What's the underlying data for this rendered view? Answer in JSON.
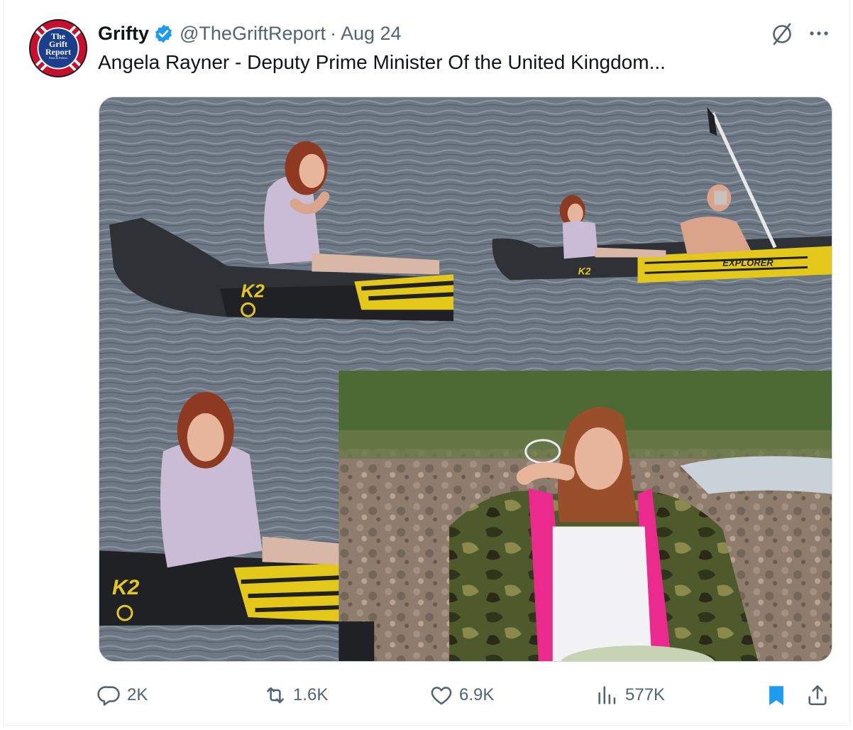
{
  "author": {
    "name": "Grifty",
    "handle": "@TheGriftReport",
    "separator": "·",
    "date": "Aug 24",
    "avatar_lines": [
      "The",
      "Grift",
      "Report"
    ],
    "avatar_subtext": "News & Politics"
  },
  "tweet": {
    "text": "Angela Rayner - Deputy Prime Minister Of the United Kingdom..."
  },
  "media": {
    "kayak_labels": [
      "K2",
      "K2",
      "K2",
      "EXPLORER"
    ]
  },
  "actions": {
    "replies": "2K",
    "reposts": "1.6K",
    "likes": "6.9K",
    "views": "577K"
  },
  "icons": {
    "verified": "verified-badge-icon",
    "grok": "grok-icon",
    "more": "more-icon",
    "reply": "reply-icon",
    "repost": "repost-icon",
    "like": "heart-icon",
    "views": "views-icon",
    "bookmark": "bookmark-icon",
    "share": "share-icon"
  },
  "colors": {
    "verified": "#1d9bf0",
    "bookmark": "#1d9bf0",
    "secondary_text": "#536471",
    "kayak_yellow": "#e3c81a",
    "jacket_pink": "#ea2a8c"
  }
}
